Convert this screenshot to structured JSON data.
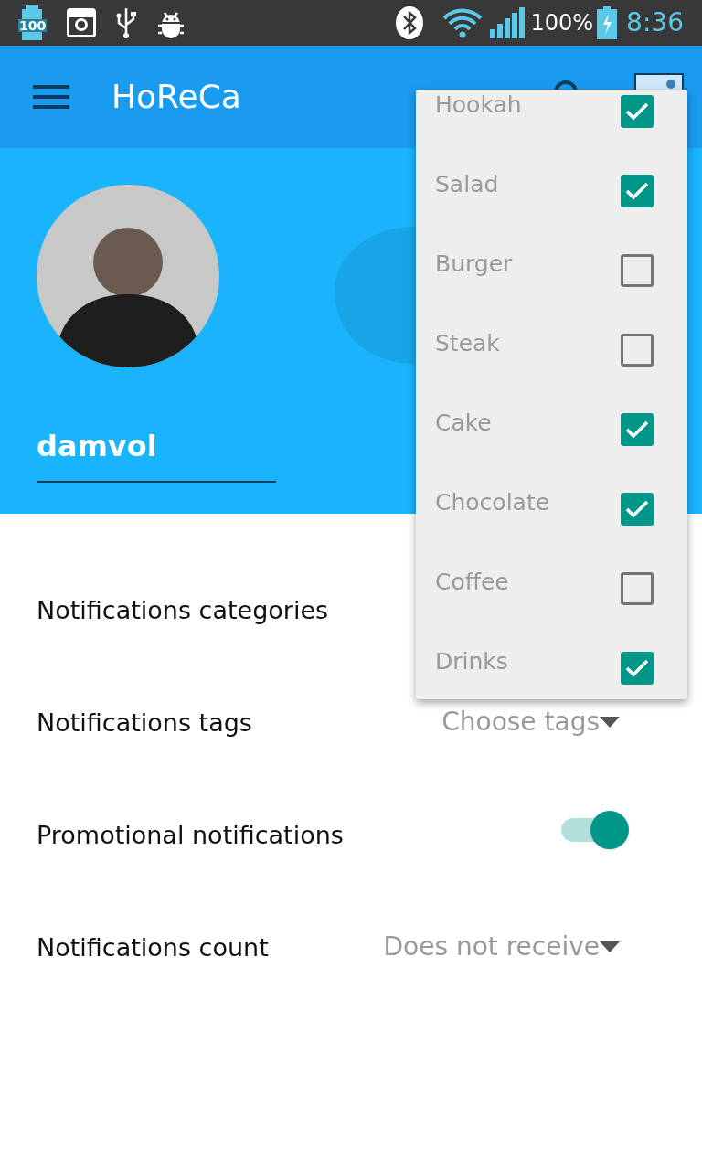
{
  "status_bar": {
    "battery_badge": "100",
    "battery_percent": "100%",
    "time": "8:36"
  },
  "app_bar": {
    "title": "HoReCa"
  },
  "profile": {
    "username": "damvol"
  },
  "settings": [
    {
      "kind": "dropdown",
      "label": "Notifications categories"
    },
    {
      "kind": "dropdown",
      "label": "Notifications tags",
      "value": "Choose tags"
    },
    {
      "kind": "toggle",
      "label": "Promotional notifications",
      "on": true
    },
    {
      "kind": "dropdown",
      "label": "Notifications count",
      "value": "Does not receive"
    }
  ],
  "category_menu": [
    {
      "label": "Hookah",
      "checked": true
    },
    {
      "label": "Salad",
      "checked": true
    },
    {
      "label": "Burger",
      "checked": false
    },
    {
      "label": "Steak",
      "checked": false
    },
    {
      "label": "Cake",
      "checked": true
    },
    {
      "label": "Chocolate",
      "checked": true
    },
    {
      "label": "Coffee",
      "checked": false
    },
    {
      "label": "Drinks",
      "checked": true
    }
  ]
}
